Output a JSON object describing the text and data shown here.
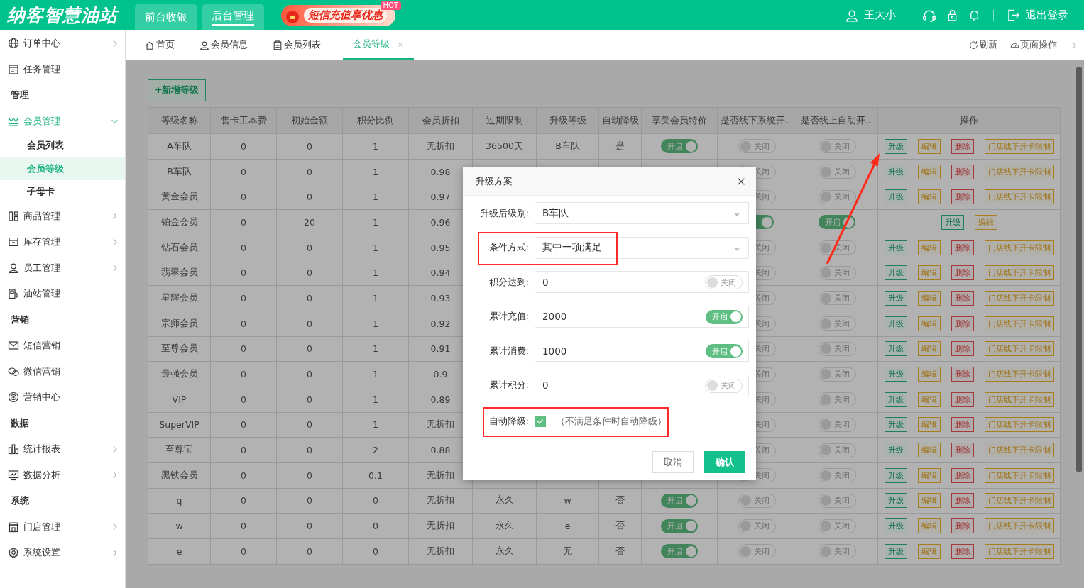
{
  "header": {
    "logo": "纳客智慧油站",
    "nav": [
      {
        "label": "前台收银",
        "selected": false
      },
      {
        "label": "后台管理",
        "selected": true
      }
    ],
    "promo": {
      "label": "短信充值享优惠",
      "badge": "HOT"
    },
    "user": "王大小",
    "logout": "退出登录"
  },
  "sidebar": {
    "items": [
      {
        "kind": "item",
        "label": "订单中心",
        "expanded": false
      },
      {
        "kind": "item",
        "label": "任务管理"
      },
      {
        "kind": "heading",
        "label": "管理"
      },
      {
        "kind": "item",
        "label": "会员管理",
        "expanded": true,
        "children": [
          {
            "label": "会员列表",
            "selected": false
          },
          {
            "label": "会员等级",
            "selected": true
          },
          {
            "label": "子母卡",
            "selected": false
          }
        ]
      },
      {
        "kind": "item",
        "label": "商品管理",
        "expanded": false
      },
      {
        "kind": "item",
        "label": "库存管理",
        "expanded": false
      },
      {
        "kind": "item",
        "label": "员工管理",
        "expanded": false
      },
      {
        "kind": "item",
        "label": "油站管理"
      },
      {
        "kind": "heading",
        "label": "营销"
      },
      {
        "kind": "item",
        "label": "短信营销"
      },
      {
        "kind": "item",
        "label": "微信营销"
      },
      {
        "kind": "item",
        "label": "营销中心"
      },
      {
        "kind": "heading",
        "label": "数据"
      },
      {
        "kind": "item",
        "label": "统计报表",
        "expanded": false
      },
      {
        "kind": "item",
        "label": "数据分析",
        "expanded": false
      },
      {
        "kind": "heading",
        "label": "系统"
      },
      {
        "kind": "item",
        "label": "门店管理",
        "expanded": false
      },
      {
        "kind": "item",
        "label": "系统设置",
        "expanded": false
      }
    ]
  },
  "tabs": [
    {
      "label": "首页",
      "selected": false
    },
    {
      "label": "会员信息",
      "selected": false
    },
    {
      "label": "会员列表",
      "selected": false
    },
    {
      "label": "会员等级",
      "selected": true,
      "closable": true
    }
  ],
  "tab_tools": [
    {
      "label": "刷新"
    },
    {
      "label": "页面操作"
    }
  ],
  "add_button": "+新增等级",
  "table": {
    "columns": [
      "等级名称",
      "售卡工本费",
      "初始金额",
      "积分比例",
      "会员折扣",
      "过期限制",
      "升级等级",
      "自动降级",
      "享受会员特价",
      "是否线下系统开...",
      "是否线上自助开...",
      "操作"
    ],
    "rows": [
      {
        "cells": [
          "A车队",
          "0",
          "0",
          "1",
          "无折扣",
          "36500天",
          "B车队",
          "是"
        ],
        "member_price": {
          "on": true,
          "label": "开启"
        },
        "offline": {
          "on": false,
          "label": "关闭"
        },
        "online": {
          "on": false,
          "label": "关闭"
        },
        "actions": [
          {
            "kind": "upgrade",
            "label": "升级"
          },
          {
            "kind": "edit",
            "label": "编辑"
          },
          {
            "kind": "delete",
            "label": "删除"
          },
          {
            "kind": "limit",
            "label": "门店线下开卡限制"
          }
        ]
      },
      {
        "cells": [
          "B车队",
          "0",
          "0",
          "1",
          "0.98",
          null,
          null,
          null
        ],
        "member_price": null,
        "offline": {
          "on": false,
          "label": "关闭"
        },
        "online": {
          "on": false,
          "label": "关闭"
        },
        "actions": [
          {
            "kind": "upgrade",
            "label": "升级"
          },
          {
            "kind": "edit",
            "label": "编辑"
          },
          {
            "kind": "delete",
            "label": "删除"
          },
          {
            "kind": "limit",
            "label": "门店线下开卡限制"
          }
        ]
      },
      {
        "cells": [
          "黄金会员",
          "0",
          "0",
          "1",
          "0.97",
          null,
          null,
          null
        ],
        "member_price": null,
        "offline": {
          "on": false,
          "label": "关闭"
        },
        "online": {
          "on": false,
          "label": "关闭"
        },
        "actions": [
          {
            "kind": "upgrade",
            "label": "升级"
          },
          {
            "kind": "edit",
            "label": "编辑"
          },
          {
            "kind": "delete",
            "label": "删除"
          },
          {
            "kind": "limit",
            "label": "门店线下开卡限制"
          }
        ]
      },
      {
        "cells": [
          "铂金会员",
          "0",
          "20",
          "1",
          "0.96",
          null,
          null,
          null
        ],
        "member_price": null,
        "offline": {
          "on": true
        },
        "online": {
          "on": true,
          "label": "开启"
        },
        "actions": [
          {
            "kind": "upgrade",
            "label": "升级"
          },
          {
            "kind": "edit",
            "label": "编辑"
          }
        ]
      },
      {
        "cells": [
          "钻石会员",
          "0",
          "0",
          "1",
          "0.95",
          null,
          null,
          null
        ],
        "member_price": null,
        "offline": {
          "on": false,
          "label": "关闭"
        },
        "online": {
          "on": false,
          "label": "关闭"
        },
        "actions": [
          {
            "kind": "upgrade",
            "label": "升级"
          },
          {
            "kind": "edit",
            "label": "编辑"
          },
          {
            "kind": "delete",
            "label": "删除"
          },
          {
            "kind": "limit",
            "label": "门店线下开卡限制"
          }
        ]
      },
      {
        "cells": [
          "翡翠会员",
          "0",
          "0",
          "1",
          "0.94",
          null,
          null,
          null
        ],
        "member_price": null,
        "offline": {
          "on": false,
          "label": "关闭"
        },
        "online": {
          "on": false,
          "label": "关闭"
        },
        "actions": [
          {
            "kind": "upgrade",
            "label": "升级"
          },
          {
            "kind": "edit",
            "label": "编辑"
          },
          {
            "kind": "delete",
            "label": "删除"
          },
          {
            "kind": "limit",
            "label": "门店线下开卡限制"
          }
        ]
      },
      {
        "cells": [
          "星耀会员",
          "0",
          "0",
          "1",
          "0.93",
          null,
          null,
          null
        ],
        "member_price": null,
        "offline": {
          "on": false,
          "label": "关闭"
        },
        "online": {
          "on": false,
          "label": "关闭"
        },
        "actions": [
          {
            "kind": "upgrade",
            "label": "升级"
          },
          {
            "kind": "edit",
            "label": "编辑"
          },
          {
            "kind": "delete",
            "label": "删除"
          },
          {
            "kind": "limit",
            "label": "门店线下开卡限制"
          }
        ]
      },
      {
        "cells": [
          "宗师会员",
          "0",
          "0",
          "1",
          "0.92",
          null,
          null,
          null
        ],
        "member_price": null,
        "offline": {
          "on": false,
          "label": "关闭"
        },
        "online": {
          "on": false,
          "label": "关闭"
        },
        "actions": [
          {
            "kind": "upgrade",
            "label": "升级"
          },
          {
            "kind": "edit",
            "label": "编辑"
          },
          {
            "kind": "delete",
            "label": "删除"
          },
          {
            "kind": "limit",
            "label": "门店线下开卡限制"
          }
        ]
      },
      {
        "cells": [
          "至尊会员",
          "0",
          "0",
          "1",
          "0.91",
          null,
          null,
          null
        ],
        "member_price": null,
        "offline": {
          "on": false,
          "label": "关闭"
        },
        "online": {
          "on": false,
          "label": "关闭"
        },
        "actions": [
          {
            "kind": "upgrade",
            "label": "升级"
          },
          {
            "kind": "edit",
            "label": "编辑"
          },
          {
            "kind": "delete",
            "label": "删除"
          },
          {
            "kind": "limit",
            "label": "门店线下开卡限制"
          }
        ]
      },
      {
        "cells": [
          "最强会员",
          "0",
          "0",
          "1",
          "0.9",
          null,
          null,
          null
        ],
        "member_price": null,
        "offline": {
          "on": false,
          "label": "关闭"
        },
        "online": {
          "on": false,
          "label": "关闭"
        },
        "actions": [
          {
            "kind": "upgrade",
            "label": "升级"
          },
          {
            "kind": "edit",
            "label": "编辑"
          },
          {
            "kind": "delete",
            "label": "删除"
          },
          {
            "kind": "limit",
            "label": "门店线下开卡限制"
          }
        ]
      },
      {
        "cells": [
          "VIP",
          "0",
          "0",
          "1",
          "0.89",
          null,
          null,
          null
        ],
        "member_price": null,
        "offline": {
          "on": false,
          "label": "关闭"
        },
        "online": {
          "on": false,
          "label": "关闭"
        },
        "actions": [
          {
            "kind": "upgrade",
            "label": "升级"
          },
          {
            "kind": "edit",
            "label": "编辑"
          },
          {
            "kind": "delete",
            "label": "删除"
          },
          {
            "kind": "limit",
            "label": "门店线下开卡限制"
          }
        ]
      },
      {
        "cells": [
          "SuperVIP",
          "0",
          "0",
          "1",
          "无折扣",
          null,
          null,
          null
        ],
        "member_price": null,
        "offline": {
          "on": false,
          "label": "关闭"
        },
        "online": {
          "on": false,
          "label": "关闭"
        },
        "actions": [
          {
            "kind": "upgrade",
            "label": "升级"
          },
          {
            "kind": "edit",
            "label": "编辑"
          },
          {
            "kind": "delete",
            "label": "删除"
          },
          {
            "kind": "limit",
            "label": "门店线下开卡限制"
          }
        ]
      },
      {
        "cells": [
          "至尊宝",
          "0",
          "0",
          "2",
          "0.88",
          null,
          null,
          null
        ],
        "member_price": null,
        "offline": {
          "on": false,
          "label": "关闭"
        },
        "online": {
          "on": false,
          "label": "关闭"
        },
        "actions": [
          {
            "kind": "upgrade",
            "label": "升级"
          },
          {
            "kind": "edit",
            "label": "编辑"
          },
          {
            "kind": "delete",
            "label": "删除"
          },
          {
            "kind": "limit",
            "label": "门店线下开卡限制"
          }
        ]
      },
      {
        "cells": [
          "黑铁会员",
          "0",
          "0",
          "0.1",
          "无折扣",
          null,
          null,
          null
        ],
        "member_price": null,
        "offline": {
          "on": false,
          "label": "关闭"
        },
        "online": {
          "on": false,
          "label": "关闭"
        },
        "actions": [
          {
            "kind": "upgrade",
            "label": "升级"
          },
          {
            "kind": "edit",
            "label": "编辑"
          },
          {
            "kind": "delete",
            "label": "删除"
          },
          {
            "kind": "limit",
            "label": "门店线下开卡限制"
          }
        ]
      },
      {
        "cells": [
          "q",
          "0",
          "0",
          "0",
          "无折扣",
          "永久",
          "w",
          "否"
        ],
        "member_price": {
          "on": true,
          "label": "开启"
        },
        "offline": {
          "on": false,
          "label": "关闭"
        },
        "online": {
          "on": false,
          "label": "关闭"
        },
        "actions": [
          {
            "kind": "upgrade",
            "label": "升级"
          },
          {
            "kind": "edit",
            "label": "编辑"
          },
          {
            "kind": "delete",
            "label": "删除"
          },
          {
            "kind": "limit",
            "label": "门店线下开卡限制"
          }
        ]
      },
      {
        "cells": [
          "w",
          "0",
          "0",
          "0",
          "无折扣",
          "永久",
          "e",
          "否"
        ],
        "member_price": {
          "on": true,
          "label": "开启"
        },
        "offline": {
          "on": false,
          "label": "关闭"
        },
        "online": {
          "on": false,
          "label": "关闭"
        },
        "actions": [
          {
            "kind": "upgrade",
            "label": "升级"
          },
          {
            "kind": "edit",
            "label": "编辑"
          },
          {
            "kind": "delete",
            "label": "删除"
          },
          {
            "kind": "limit",
            "label": "门店线下开卡限制"
          }
        ]
      },
      {
        "cells": [
          "e",
          "0",
          "0",
          "0",
          "无折扣",
          "永久",
          "无",
          "否"
        ],
        "member_price": {
          "on": true,
          "label": "开启"
        },
        "offline": {
          "on": false,
          "label": "关闭"
        },
        "online": {
          "on": false,
          "label": "关闭"
        },
        "actions": [
          {
            "kind": "upgrade",
            "label": "升级"
          },
          {
            "kind": "edit",
            "label": "编辑"
          },
          {
            "kind": "delete",
            "label": "删除"
          },
          {
            "kind": "limit",
            "label": "门店线下开卡限制"
          }
        ]
      }
    ]
  },
  "dialog": {
    "title": "升级方案",
    "fields": [
      {
        "kind": "select",
        "label": "升级后级别:",
        "value": "B车队"
      },
      {
        "kind": "select",
        "label": "条件方式:",
        "value": "其中一项满足",
        "highlighted": true
      },
      {
        "kind": "input",
        "label": "积分达到:",
        "value": "0",
        "toggle": {
          "on": false,
          "label": "关闭"
        }
      },
      {
        "kind": "input",
        "label": "累计充值:",
        "value": "2000",
        "toggle": {
          "on": true,
          "label": "开启"
        }
      },
      {
        "kind": "input",
        "label": "累计消费:",
        "value": "1000",
        "toggle": {
          "on": true,
          "label": "开启"
        }
      },
      {
        "kind": "input",
        "label": "累计积分:",
        "value": "0",
        "toggle": {
          "on": false,
          "label": "关闭"
        }
      },
      {
        "kind": "checkbox",
        "label": "自动降级:",
        "checked": true,
        "hint": "（不满足条件时自动降级）",
        "highlighted": true
      }
    ],
    "buttons": [
      {
        "kind": "secondary",
        "label": "取消"
      },
      {
        "kind": "primary",
        "label": "确认"
      }
    ]
  }
}
